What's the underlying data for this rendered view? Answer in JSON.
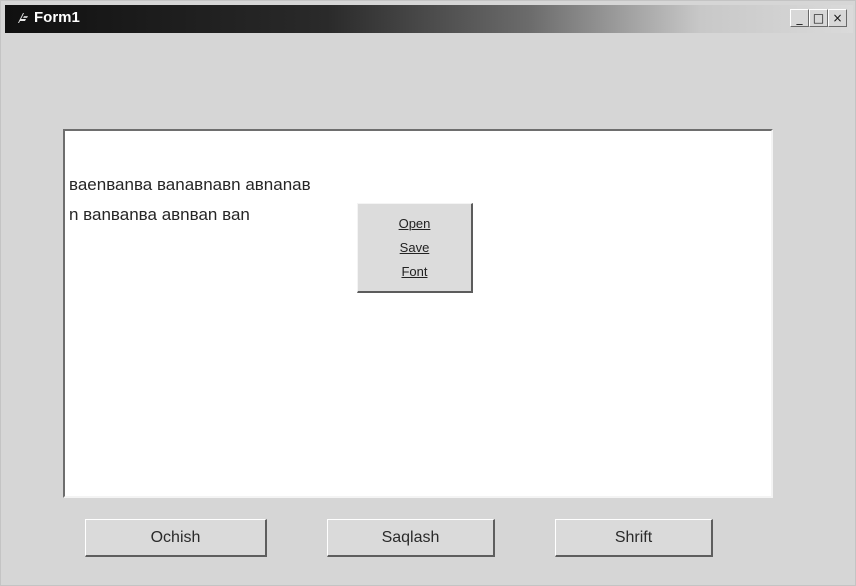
{
  "window": {
    "title": "Form1",
    "controls": {
      "minimize": "_",
      "maximize": "□",
      "close": "×"
    }
  },
  "memo": {
    "lines": [
      "ваеnваnва ваnавnавn авnаnав",
      "n  ваnваnва авnваn ваn"
    ]
  },
  "popup_menu": {
    "items": [
      "Open",
      "Save",
      "Font"
    ]
  },
  "buttons": {
    "clear_label": "Ochish",
    "save_label": "Saqlash",
    "font_label": "Shrift"
  },
  "colors": {
    "window_bg": "#d6d6d6",
    "title_dark": "#101010",
    "title_light": "#dadada",
    "memo_bg": "#ffffff"
  },
  "icons": {
    "app": "delphi-form-icon"
  }
}
